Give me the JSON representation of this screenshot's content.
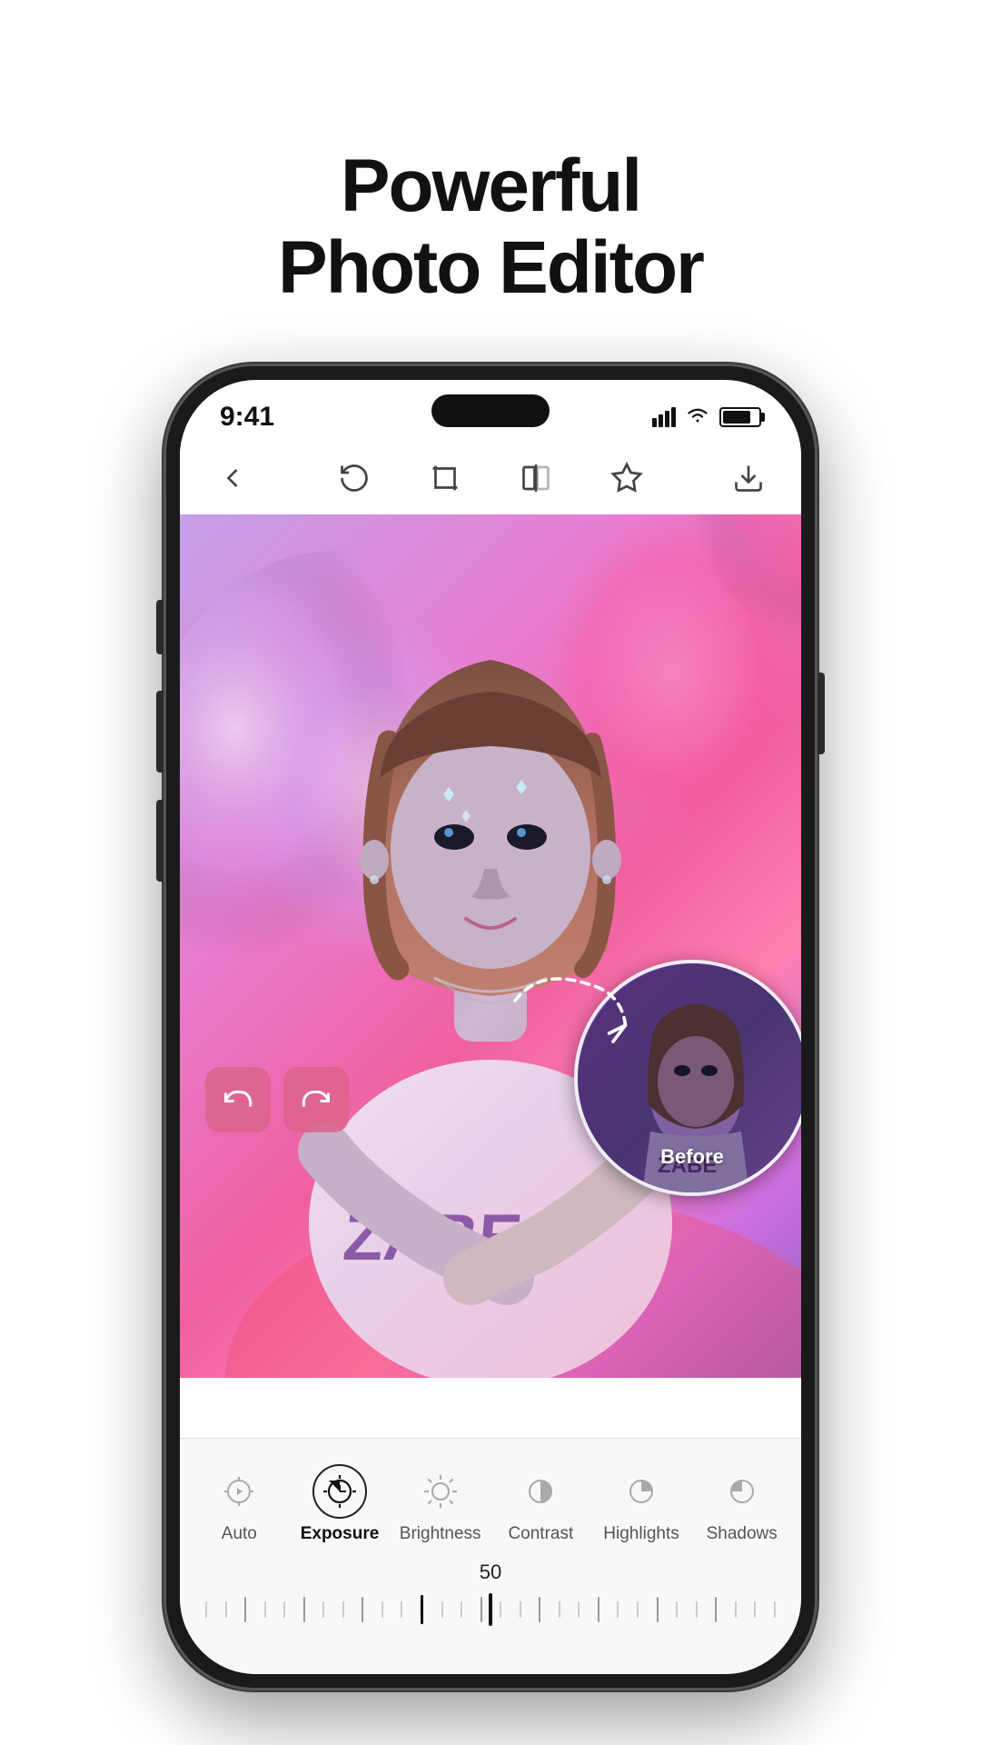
{
  "headline": {
    "line1": "Powerful",
    "line2": "Photo Editor"
  },
  "status_bar": {
    "time": "9:41",
    "signal": "signal",
    "wifi": "wifi",
    "battery": "battery"
  },
  "toolbar": {
    "back_label": "back",
    "rotate_label": "rotate",
    "crop_label": "crop",
    "flip_label": "flip",
    "adjust_label": "adjust",
    "download_label": "download"
  },
  "tools": [
    {
      "id": "auto",
      "label": "Auto",
      "active": false
    },
    {
      "id": "exposure",
      "label": "Exposure",
      "active": true
    },
    {
      "id": "brightness",
      "label": "Brightness",
      "active": false
    },
    {
      "id": "contrast",
      "label": "Contrast",
      "active": false
    },
    {
      "id": "highlights",
      "label": "Highlights",
      "active": false
    },
    {
      "id": "shadows",
      "label": "Shadows",
      "active": false
    }
  ],
  "slider": {
    "value": "50",
    "min": "0",
    "max": "100"
  },
  "before_label": "Before",
  "colors": {
    "accent": "#e05090",
    "active_tool": "#111111",
    "photo_bg": "#c070d0"
  }
}
